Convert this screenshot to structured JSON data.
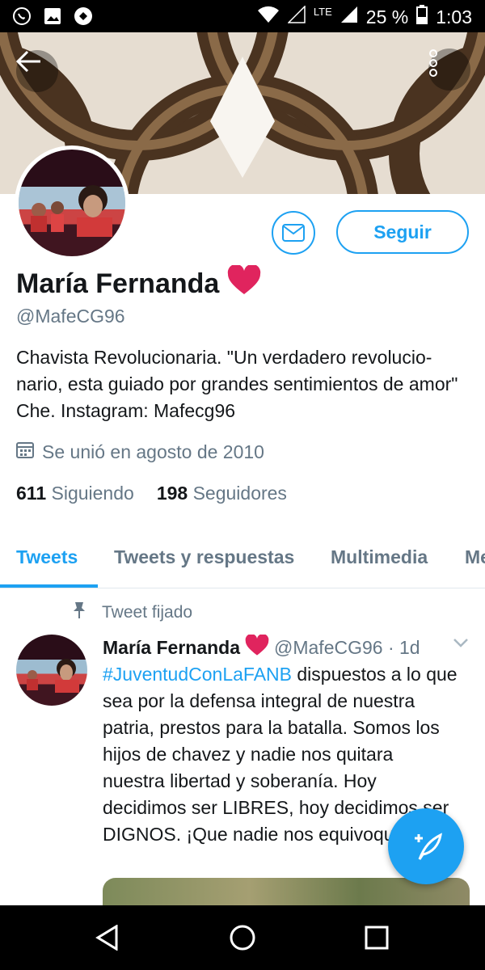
{
  "status_bar": {
    "battery": "25 %",
    "time": "1:03",
    "network": "LTE",
    "left_icons": [
      "whatsapp-icon",
      "image-icon",
      "app-icon"
    ]
  },
  "profile": {
    "name": "María Fernanda",
    "name_emoji": "❤️",
    "handle": "@MafeCG96",
    "bio": "Chavista Revolucionaria. \"Un verdadero revolucio-nario, esta guiado por grandes sentimientos de amor\" Che.   Instagram: Mafecg96",
    "joined": "Se unió en agosto de 2010",
    "following_count": "611",
    "following_label": "Siguiendo",
    "followers_count": "198",
    "followers_label": "Seguidores",
    "follow_label": "Seguir"
  },
  "tabs": [
    {
      "label": "Tweets",
      "active": true
    },
    {
      "label": "Tweets y respuestas",
      "active": false
    },
    {
      "label": "Multimedia",
      "active": false
    },
    {
      "label": "Me",
      "active": false
    }
  ],
  "pinned_tweet": {
    "pinned_label": "Tweet fijado",
    "author_name": "María Fernanda",
    "author_emoji": "❤️",
    "meta": "@MafeCG96 · 1d",
    "hashtag": "#JuventudConLaFANB",
    "text": " dispuestos a lo que sea por la defensa integral de nuestra patria, prestos para la batalla. Somos los hijos de chavez y nadie nos quitara nuestra libertad y soberanía. Hoy decidimos ser LIBRES, hoy decidimos ser DIGNOS. ¡Que nadie nos equivoque!"
  },
  "colors": {
    "accent": "#1da1f2",
    "secondary_text": "#657786"
  }
}
